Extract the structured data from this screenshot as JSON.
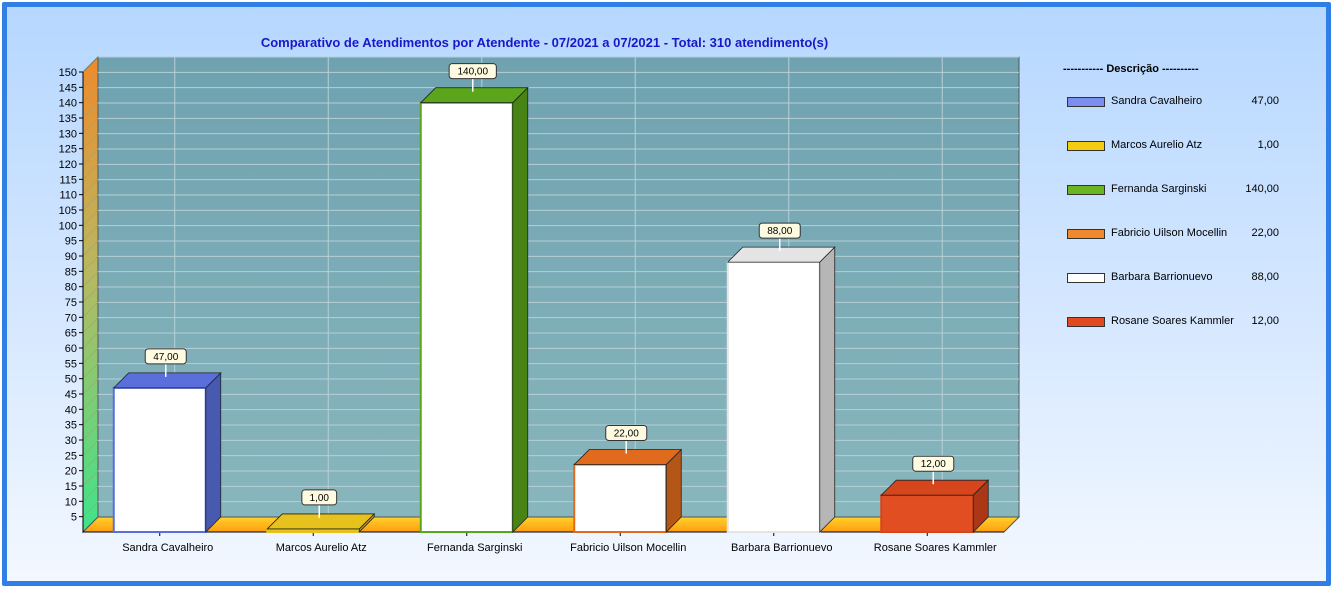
{
  "chart_data": {
    "type": "bar",
    "title": "Comparativo de Atendimentos por Atendente - 07/2021 a 07/2021 - Total: 310 atendimento(s)",
    "categories": [
      "Sandra Cavalheiro",
      "Marcos Aurelio Atz",
      "Fernanda Sarginski",
      "Fabricio Uilson Mocellin",
      "Barbara Barrionuevo",
      "Rosane Soares Kammler"
    ],
    "values": [
      47,
      1,
      140,
      22,
      88,
      12
    ],
    "value_labels": [
      "47,00",
      "1,00",
      "140,00",
      "22,00",
      "88,00",
      "12,00"
    ],
    "bar_colors": [
      "#5a6fdc",
      "#e8c21c",
      "#5aa51a",
      "#e06b1c",
      "#e4e4e4",
      "#d6451c"
    ],
    "bar_front": [
      "#ffffff",
      "#e8c21c",
      "#ffffff",
      "#ffffff",
      "#ffffff",
      "#e04e22"
    ],
    "ylim": [
      0,
      150
    ],
    "yticks": [
      5,
      10,
      15,
      20,
      25,
      30,
      35,
      40,
      45,
      50,
      55,
      60,
      65,
      70,
      75,
      80,
      85,
      90,
      95,
      100,
      105,
      110,
      115,
      120,
      125,
      130,
      135,
      140,
      145,
      150
    ],
    "grid": true,
    "legend_position": "right"
  },
  "legend": {
    "header": "----------- Descrição ----------",
    "items": [
      {
        "label": "Sandra Cavalheiro",
        "value": "47,00",
        "color": "#7b8ef0"
      },
      {
        "label": "Marcos Aurelio Atz",
        "value": "1,00",
        "color": "#f4cd10"
      },
      {
        "label": "Fernanda Sarginski",
        "value": "140,00",
        "color": "#6ab520"
      },
      {
        "label": "Fabricio Uilson Mocellin",
        "value": "22,00",
        "color": "#f0882c"
      },
      {
        "label": "Barbara Barrionuevo",
        "value": "88,00",
        "color": "#ffffff"
      },
      {
        "label": "Rosane Soares Kammler",
        "value": "12,00",
        "color": "#e04a1e"
      }
    ]
  }
}
